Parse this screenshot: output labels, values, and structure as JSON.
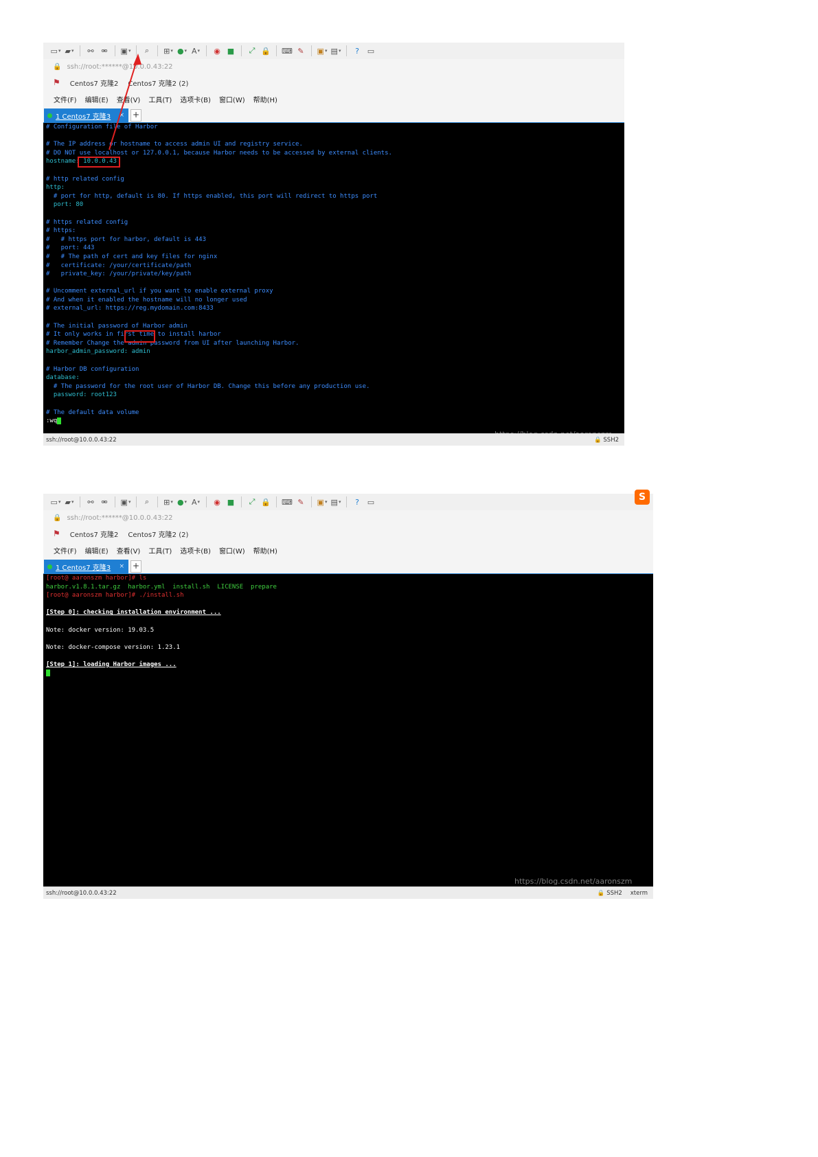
{
  "screenshots": [
    {
      "address": "ssh://root:******@10.0.0.43:22",
      "sessions": [
        "Centos7 克隆2",
        "Centos7 克隆2 (2)"
      ],
      "menu": [
        "文件(F)",
        "编辑(E)",
        "查看(V)",
        "工具(T)",
        "选项卡(B)",
        "窗口(W)",
        "帮助(H)"
      ],
      "tab_label": "1 Centos7 克隆3",
      "status_left": "ssh://root@10.0.0.43:22",
      "status_protocol": "SSH2",
      "watermark": "https://blog.csdn.net/aaronszm",
      "terminal": [
        "# Configuration file of Harbor",
        "",
        "# The IP address or hostname to access admin UI and registry service.",
        "# DO NOT use localhost or 127.0.0.1, because Harbor needs to be accessed by external clients.",
        "hostname: 10.0.0.43",
        "",
        "# http related config",
        "http:",
        "  # port for http, default is 80. If https enabled, this port will redirect to https port",
        "  port: 80",
        "",
        "# https related config",
        "# https:",
        "#   # https port for harbor, default is 443",
        "#   port: 443",
        "#   # The path of cert and key files for nginx",
        "#   certificate: /your/certificate/path",
        "#   private_key: /your/private/key/path",
        "",
        "# Uncomment external_url if you want to enable external proxy",
        "# And when it enabled the hostname will no longer used",
        "# external_url: https://reg.mydomain.com:8433",
        "",
        "# The initial password of Harbor admin",
        "# It only works in first time to install harbor",
        "# Remember Change the admin password from UI after launching Harbor.",
        "harbor_admin_password: admin",
        "",
        "# Harbor DB configuration",
        "database:",
        "  # The password for the root user of Harbor DB. Change this before any production use.",
        "  password: root123",
        "",
        "# The default data volume",
        ":wq"
      ]
    },
    {
      "address": "ssh://root:******@10.0.0.43:22",
      "sessions": [
        "Centos7 克隆2",
        "Centos7 克隆2 (2)"
      ],
      "menu": [
        "文件(F)",
        "编辑(E)",
        "查看(V)",
        "工具(T)",
        "选项卡(B)",
        "窗口(W)",
        "帮助(H)"
      ],
      "tab_label": "1 Centos7 克隆3",
      "status_left": "ssh://root@10.0.0.43:22",
      "status_protocol": "SSH2",
      "status_term": "xterm",
      "watermark": "https://blog.csdn.net/aaronszm",
      "terminal": [
        "[root@ aaronszm harbor]# ls",
        "harbor.v1.8.1.tar.gz  harbor.yml  install.sh  LICENSE  prepare",
        "[root@ aaronszm harbor]# ./install.sh",
        "",
        "[Step 0]: checking installation environment ...",
        "",
        "Note: docker version: 19.03.5",
        "",
        "Note: docker-compose version: 1.23.1",
        "",
        "[Step 1]: loading Harbor images ..."
      ]
    }
  ],
  "colors": {
    "accent": "#1f7fd3",
    "highlight_box": "#e02020",
    "terminal_bg": "#000000",
    "comment": "#3d8dff",
    "key": "#2fbfd1",
    "prompt": "#e03030",
    "exec": "#40d040"
  }
}
